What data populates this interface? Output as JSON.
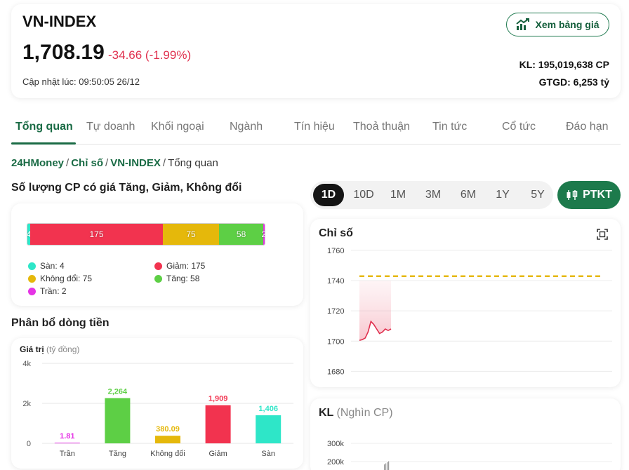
{
  "header": {
    "symbol": "VN-INDEX",
    "price": "1,708.19",
    "change": "-34.66 (-1.99%)",
    "updated": "Cập nhật lúc: 09:50:05 26/12",
    "board_button": "Xem bảng giá",
    "volume": "KL: 195,019,638 CP",
    "value": "GTGD: 6,253 tỷ",
    "down_color": "#e0304e"
  },
  "tabs": [
    "Tổng quan",
    "Tự doanh",
    "Khối ngoại",
    "Ngành",
    "Tín hiệu",
    "Thoả thuận",
    "Tin tức",
    "Cổ tức",
    "Đáo hạn"
  ],
  "breadcrumb": [
    "24HMoney",
    "Chỉ số",
    "VN-INDEX",
    "Tổng quan"
  ],
  "count_section": {
    "title": "Số lượng CP có giá Tăng, Giảm, Không đổi",
    "segments": [
      {
        "key": "san",
        "value": 4,
        "color": "#2ee6c8"
      },
      {
        "key": "giam",
        "value": 175,
        "color": "#f2334f"
      },
      {
        "key": "khongdoi",
        "value": 75,
        "color": "#e5b80b"
      },
      {
        "key": "tang",
        "value": 58,
        "color": "#5dcf45"
      },
      {
        "key": "tran",
        "value": 2,
        "color": "#e534e5"
      }
    ],
    "legend": {
      "san": "Sàn: 4",
      "giam": "Giảm: 175",
      "khongdoi": "Không đổi: 75",
      "tang": "Tăng: 58",
      "tran": "Trần: 2"
    }
  },
  "flow_section": {
    "title": "Phân bổ dòng tiền",
    "chart_label": "Giá trị",
    "chart_unit": "(tỷ đồng)"
  },
  "chart_data": [
    {
      "type": "bar",
      "categories": [
        "Trần",
        "Tăng",
        "Không đổi",
        "Giảm",
        "Sàn"
      ],
      "values": [
        1.81,
        2264,
        380.09,
        1909,
        1406
      ],
      "labels": [
        "1.81",
        "2,264",
        "380.09",
        "1,909",
        "1,406"
      ],
      "colors": [
        "#e534e5",
        "#5dcf45",
        "#e5b80b",
        "#f2334f",
        "#2ee6c8"
      ],
      "ylim": [
        0,
        4000
      ],
      "yticks": [
        "0",
        "2k",
        "4k"
      ],
      "grid": true
    },
    {
      "type": "line",
      "title": "Chỉ số",
      "ylim": [
        1670,
        1765
      ],
      "yticks": [
        1760,
        1740,
        1720,
        1700,
        1680
      ],
      "reference": 1742.85,
      "reference_color": "#e5b80b",
      "series": [
        {
          "values": [
            1700.5,
            1701,
            1702,
            1706,
            1713,
            1711,
            1708,
            1705,
            1706,
            1708,
            1707,
            1708
          ]
        }
      ]
    },
    {
      "type": "bar",
      "title": "KL",
      "yticks": [
        "300k",
        "200k"
      ]
    }
  ],
  "periods": [
    "1D",
    "10D",
    "1M",
    "3M",
    "6M",
    "1Y",
    "5Y"
  ],
  "ptkt_label": "PTKT",
  "volume_section": {
    "title": "KL",
    "unit": "(Nghìn CP)"
  }
}
